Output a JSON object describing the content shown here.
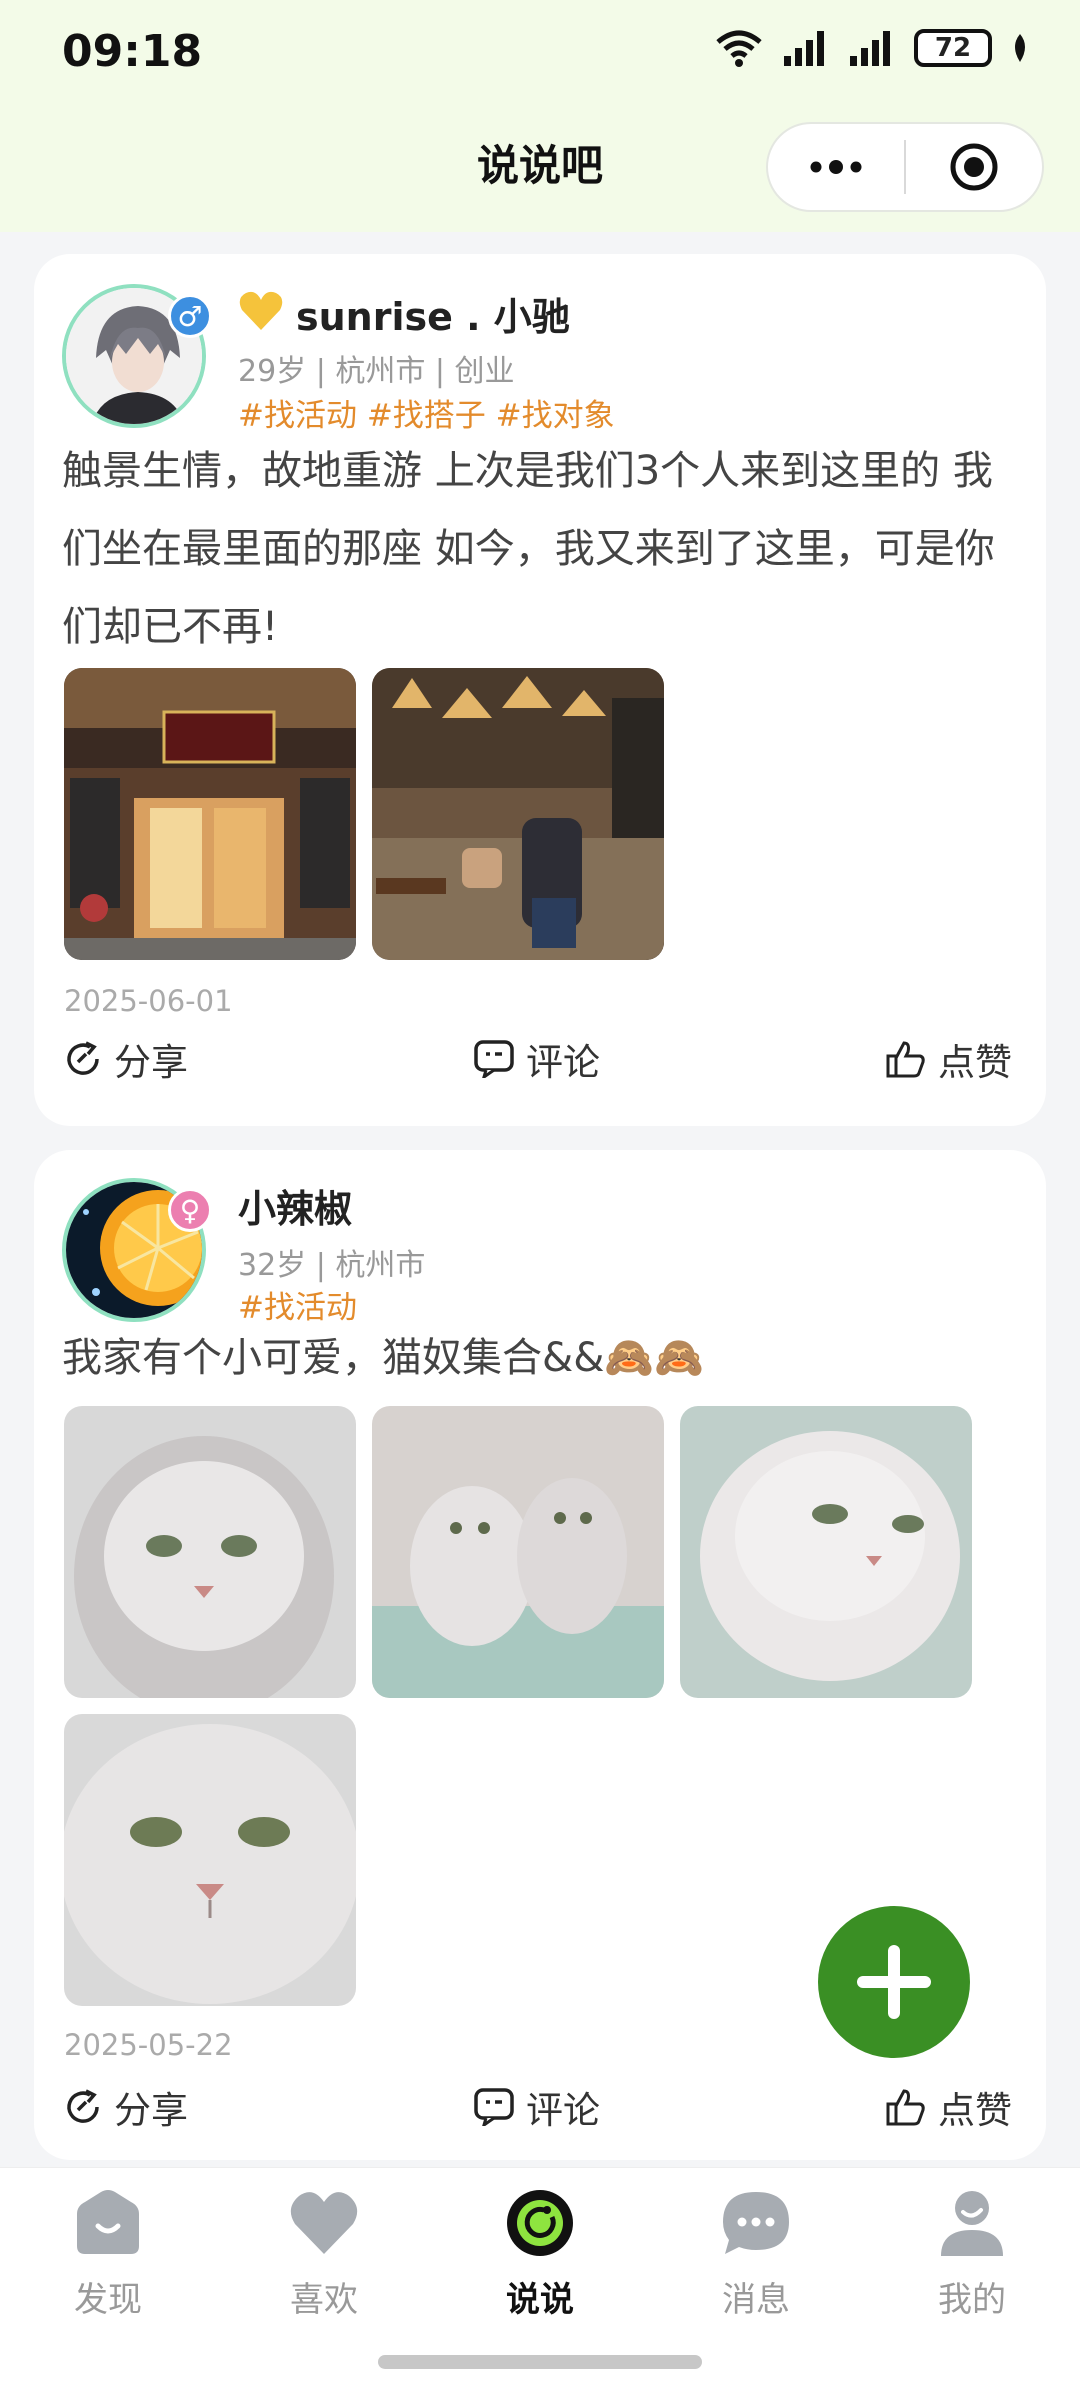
{
  "status_bar": {
    "time": "09:18",
    "battery": "72"
  },
  "nav": {
    "title": "说说吧"
  },
  "posts": [
    {
      "username": "sunrise . 小驰",
      "gender_symbol": "♂",
      "meta": "29岁 | 杭州市 | 创业",
      "tags": "#找活动 #找搭子 #找对象",
      "content": "触景生情，故地重游 上次是我们3个人来到这里的 我们坐在最里面的那座 如今，我又来到了这里，可是你们却已不再!",
      "photos": [
        "restaurant-exterior",
        "restaurant-interior"
      ],
      "date": "2025-06-01",
      "actions": {
        "share": "分享",
        "comment": "评论",
        "like": "点赞"
      }
    },
    {
      "username": "小辣椒",
      "gender_symbol": "♀",
      "meta": "32岁 | 杭州市",
      "tags": "#找活动",
      "content": "我家有个小可爱，猫奴集合&&🙈🙈",
      "photos": [
        "cat-photo-1",
        "cat-photo-2",
        "cat-photo-3",
        "cat-photo-4"
      ],
      "date": "2025-05-22",
      "actions": {
        "share": "分享",
        "comment": "评论",
        "like": "点赞"
      }
    }
  ],
  "tabs": [
    {
      "label": "发现",
      "icon": "home-icon"
    },
    {
      "label": "喜欢",
      "icon": "heart-icon"
    },
    {
      "label": "说说",
      "icon": "moments-icon",
      "active": true
    },
    {
      "label": "消息",
      "icon": "message-icon"
    },
    {
      "label": "我的",
      "icon": "profile-icon"
    }
  ],
  "colors": {
    "accent": "#3a8f24",
    "tag": "#e38b2c",
    "header_bg": "#f3fbe8",
    "male": "#3d8fe0",
    "female": "#ec7fb0"
  }
}
